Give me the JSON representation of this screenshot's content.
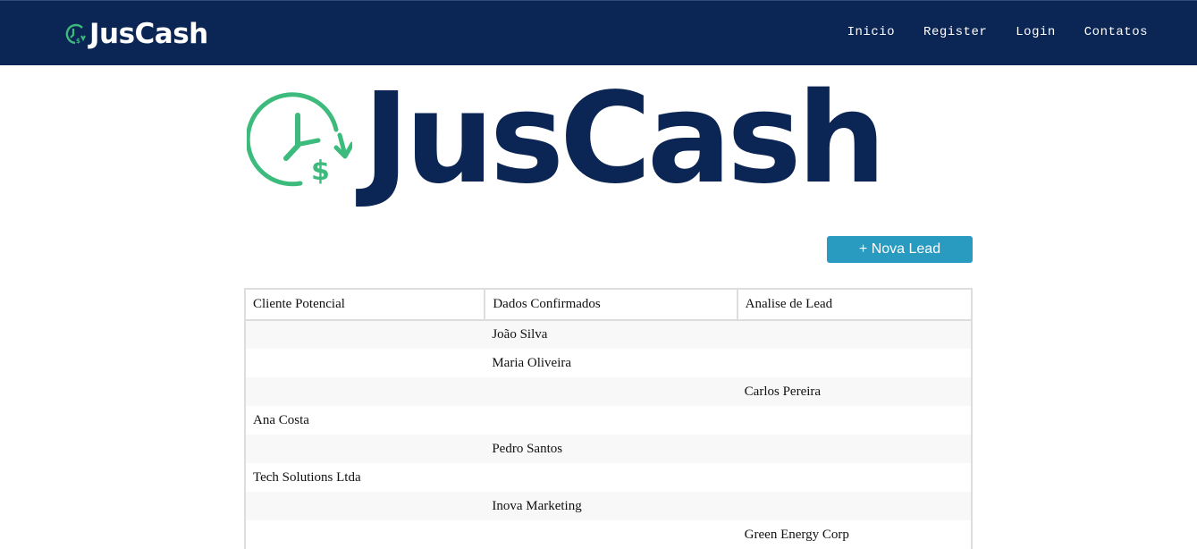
{
  "brand": {
    "name": "JusCash",
    "colors": {
      "navy": "#0b2654",
      "green": "#3dbb7c",
      "accent": "#2a9bc0"
    }
  },
  "nav": {
    "links": [
      "Inicio",
      "Register",
      "Login",
      "Contatos"
    ]
  },
  "hero": {
    "logo_text": "JusCash",
    "icon": "clock-dollar-icon"
  },
  "actions": {
    "new_lead_label": "+ Nova Lead"
  },
  "table": {
    "columns": [
      "Cliente Potencial",
      "Dados Confirmados",
      "Analise de Lead"
    ],
    "rows": [
      [
        "",
        "João Silva",
        ""
      ],
      [
        "",
        "Maria Oliveira",
        ""
      ],
      [
        "",
        "",
        "Carlos Pereira"
      ],
      [
        "Ana Costa",
        "",
        ""
      ],
      [
        "",
        "Pedro Santos",
        ""
      ],
      [
        "Tech Solutions Ltda",
        "",
        ""
      ],
      [
        "",
        "Inova Marketing",
        ""
      ],
      [
        "",
        "",
        "Green Energy Corp"
      ]
    ]
  }
}
